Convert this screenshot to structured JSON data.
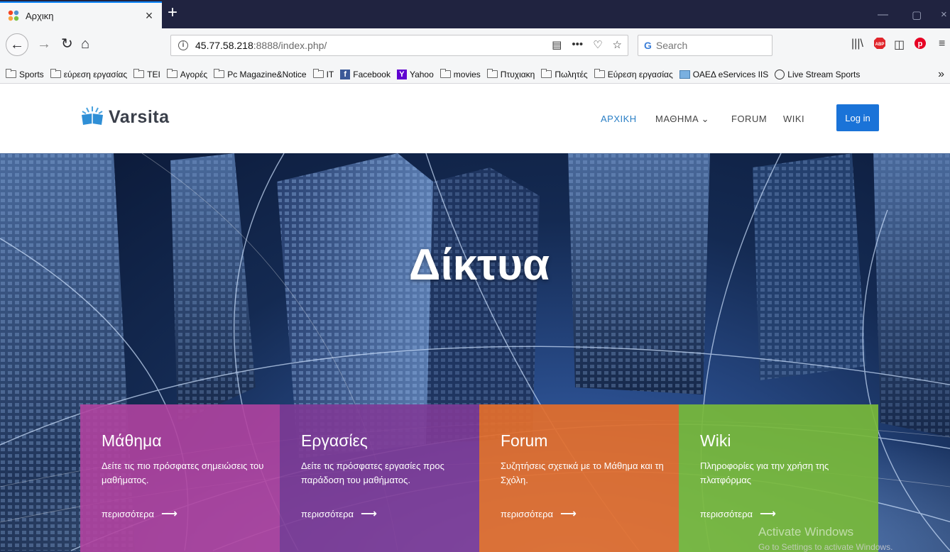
{
  "browser": {
    "tab_title": "Αρχικη",
    "url_host": "45.77.58.218",
    "url_path": ":8888/index.php/",
    "search_placeholder": "Search",
    "bookmarks": [
      {
        "label": "Sports",
        "icon": "folder-icon"
      },
      {
        "label": "εύρεση εργασίας",
        "icon": "folder-icon"
      },
      {
        "label": "TEI",
        "icon": "folder-icon"
      },
      {
        "label": "Αγορές",
        "icon": "folder-icon"
      },
      {
        "label": "Pc Magazine&Notice",
        "icon": "folder-icon"
      },
      {
        "label": "IT",
        "icon": "folder-icon"
      },
      {
        "label": "Facebook",
        "icon": "facebook-icon"
      },
      {
        "label": "Yahoo",
        "icon": "yahoo-icon"
      },
      {
        "label": "movies",
        "icon": "folder-icon"
      },
      {
        "label": "Πτυχιακη",
        "icon": "folder-icon"
      },
      {
        "label": "Πωλητές",
        "icon": "folder-icon"
      },
      {
        "label": "Εύρεση εργασίας",
        "icon": "folder-icon"
      },
      {
        "label": "ΟΑΕΔ eServices IIS",
        "icon": "page-icon"
      },
      {
        "label": "Live Stream Sports",
        "icon": "globe-icon"
      }
    ]
  },
  "site": {
    "logo_text": "Varsita",
    "nav": {
      "home": "ΑΡΧΙΚΗ",
      "course": "ΜΑΘΗΜΑ",
      "forum": "FORUM",
      "wiki": "WIKI",
      "login": "Log in"
    },
    "hero_title": "Δίκτυα",
    "cards": [
      {
        "title": "Μάθημα",
        "text": "Δείτε τις πιο πρόσφατες σημειώσεις του μαθήματος.",
        "more": "περισσότερα",
        "color": "#b042a0"
      },
      {
        "title": "Εργασίες",
        "text": "Δείτε τις πρόσφατες εργασίες προς παράδοση του μαθήματος.",
        "more": "περισσότερα",
        "color": "#7e3a96"
      },
      {
        "title": "Forum",
        "text": "Συζητήσεις σχετικά με το Μάθημα και τη Σχόλη.",
        "more": "περισσότερα",
        "color": "#e26e2c"
      },
      {
        "title": "Wiki",
        "text": "Πληροφορίες για την χρήση της πλατφόρμας",
        "more": "περισσότερα",
        "color": "#78ba3a"
      }
    ]
  },
  "os": {
    "activate_title": "Activate Windows",
    "activate_sub": "Go to Settings to activate Windows."
  },
  "colors": {
    "accent": "#1a73d8",
    "nav_active": "#2a7fc6",
    "tabstrip": "#202340"
  }
}
